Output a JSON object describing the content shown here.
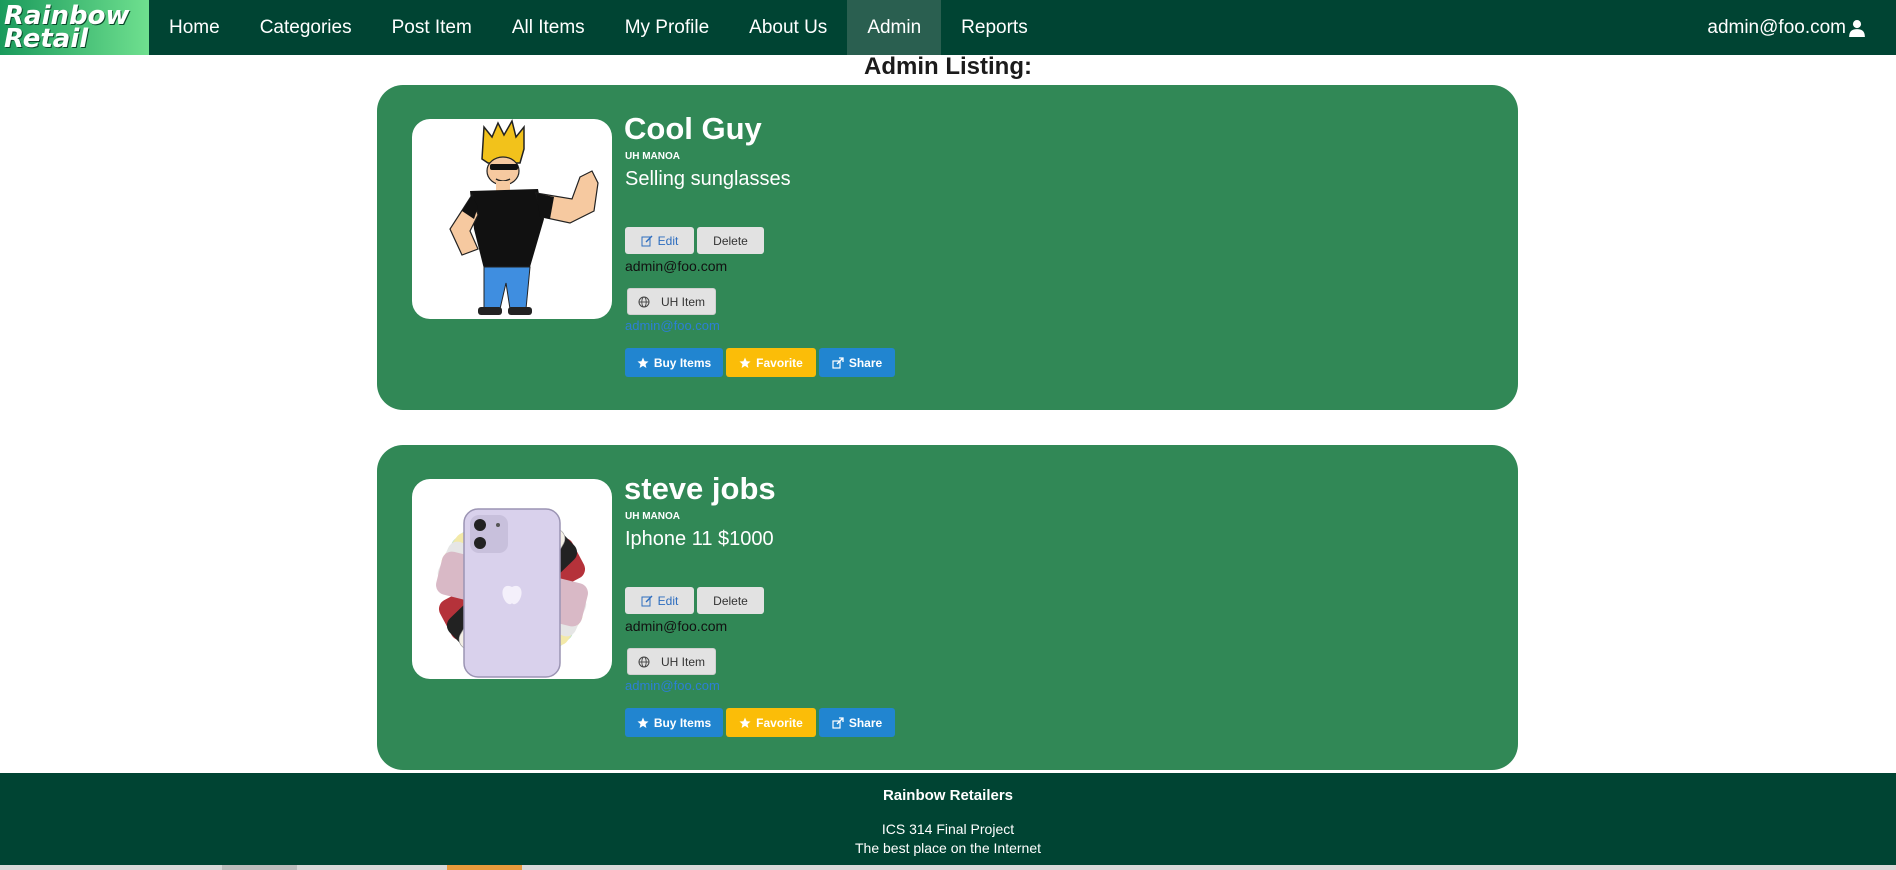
{
  "navbar": {
    "logo_line1": "Rainbow",
    "logo_line2": "Retail",
    "items": [
      "Home",
      "Categories",
      "Post Item",
      "All Items",
      "My Profile",
      "About Us",
      "Admin",
      "Reports"
    ],
    "active_item": "Admin",
    "user_email": "admin@foo.com",
    "user_icon": "user-icon"
  },
  "page": {
    "title": "Admin Listing:"
  },
  "listings": [
    {
      "name": "Cool Guy",
      "school": "UH MANOA",
      "description": "Selling sunglasses",
      "edit_label": "Edit",
      "delete_label": "Delete",
      "owner": "admin@foo.com",
      "tag_label": "UH Item",
      "contact_link": "admin@foo.com",
      "buy_label": "Buy Items",
      "favorite_label": "Favorite",
      "share_label": "Share",
      "image": "cartoon-muscle-man-image"
    },
    {
      "name": "steve jobs",
      "school": "UH MANOA",
      "description": "Iphone 11 $1000",
      "edit_label": "Edit",
      "delete_label": "Delete",
      "owner": "admin@foo.com",
      "tag_label": "UH Item",
      "contact_link": "admin@foo.com",
      "buy_label": "Buy Items",
      "favorite_label": "Favorite",
      "share_label": "Share",
      "image": "iphone-11-colors-image"
    }
  ],
  "footer": {
    "title": "Rainbow Retailers",
    "line1": "ICS 314 Final Project",
    "line2": "The best place on the Internet"
  },
  "colors": {
    "navbar": "#004433",
    "card": "#318856",
    "primary_button": "#2185d0",
    "favorite_button": "#fbbd08"
  }
}
